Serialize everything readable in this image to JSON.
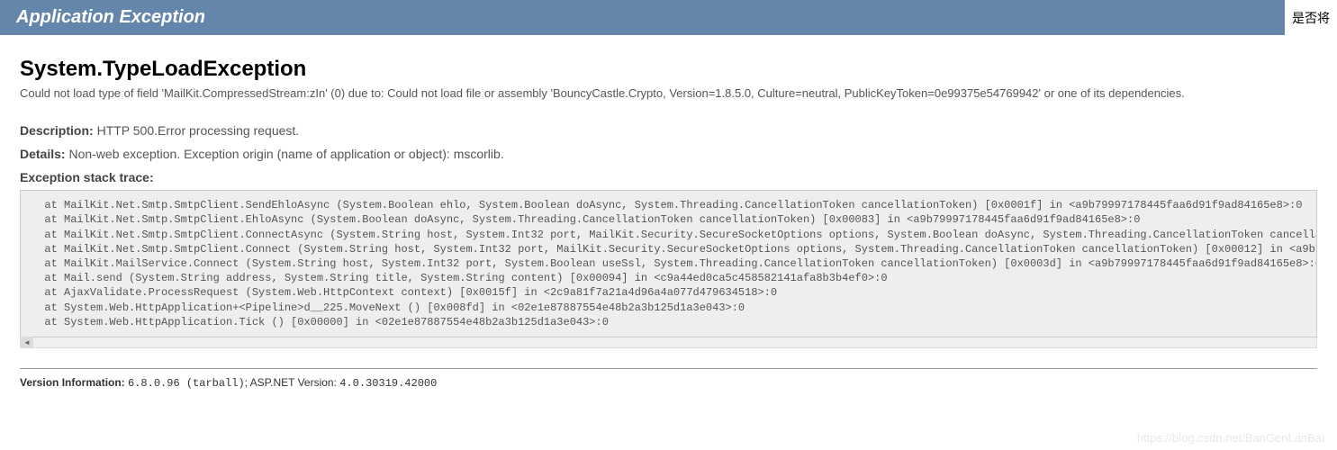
{
  "header": {
    "title": "Application Exception",
    "right_text": "是否将"
  },
  "exception": {
    "type": "System.TypeLoadException",
    "message": "Could not load type of field 'MailKit.CompressedStream:zIn' (0) due to: Could not load file or assembly 'BouncyCastle.Crypto, Version=1.8.5.0, Culture=neutral, PublicKeyToken=0e99375e54769942' or one of its dependencies."
  },
  "description": {
    "label": "Description:",
    "value": "HTTP 500.Error processing request."
  },
  "details": {
    "label": "Details:",
    "value": "Non-web exception. Exception origin (name of application or object): mscorlib."
  },
  "stack": {
    "label": "Exception stack trace:",
    "trace": "  at MailKit.Net.Smtp.SmtpClient.SendEhloAsync (System.Boolean ehlo, System.Boolean doAsync, System.Threading.CancellationToken cancellationToken) [0x0001f] in <a9b79997178445faa6d91f9ad84165e8>:0\n  at MailKit.Net.Smtp.SmtpClient.EhloAsync (System.Boolean doAsync, System.Threading.CancellationToken cancellationToken) [0x00083] in <a9b79997178445faa6d91f9ad84165e8>:0\n  at MailKit.Net.Smtp.SmtpClient.ConnectAsync (System.String host, System.Int32 port, MailKit.Security.SecureSocketOptions options, System.Boolean doAsync, System.Threading.CancellationToken cancellationToken\n  at MailKit.Net.Smtp.SmtpClient.Connect (System.String host, System.Int32 port, MailKit.Security.SecureSocketOptions options, System.Threading.CancellationToken cancellationToken) [0x00012] in <a9b799971784\n  at MailKit.MailService.Connect (System.String host, System.Int32 port, System.Boolean useSsl, System.Threading.CancellationToken cancellationToken) [0x0003d] in <a9b79997178445faa6d91f9ad84165e8>:0\n  at Mail.send (System.String address, System.String title, System.String content) [0x00094] in <c9a44ed0ca5c458582141afa8b3b4ef0>:0\n  at AjaxValidate.ProcessRequest (System.Web.HttpContext context) [0x0015f] in <2c9a81f7a21a4d96a4a077d479634518>:0\n  at System.Web.HttpApplication+<Pipeline>d__225.MoveNext () [0x008fd] in <02e1e87887554e48b2a3b125d1a3e043>:0\n  at System.Web.HttpApplication.Tick () [0x00000] in <02e1e87887554e48b2a3b125d1a3e043>:0"
  },
  "version": {
    "label": "Version Information:",
    "mono": "6.8.0.96 (tarball)",
    "aspnet_label": "; ASP.NET Version:",
    "aspnet": "4.0.30319.42000"
  },
  "watermark": "https://blog.csdn.net/BanGenLanBai"
}
